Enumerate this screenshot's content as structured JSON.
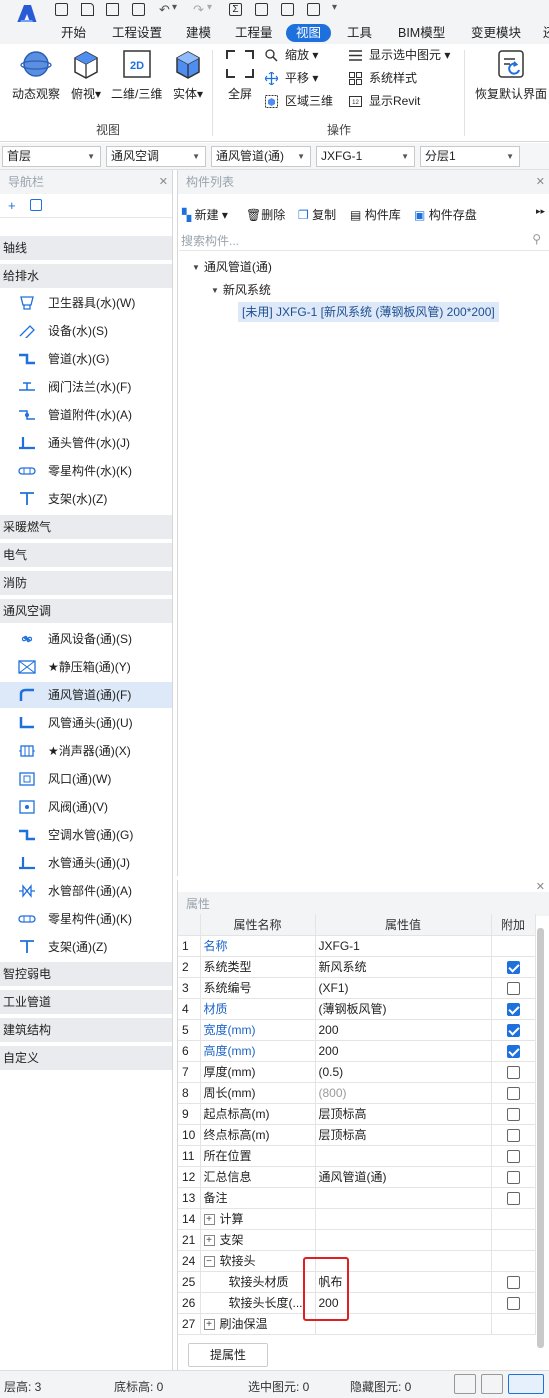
{
  "menu_tabs": [
    "开始",
    "工程设置",
    "建模",
    "工程量",
    "视图",
    "工具",
    "BIM模型",
    "变更模块",
    "还"
  ],
  "active_tab": "视图",
  "ribbon": {
    "view_group": {
      "label": "视图",
      "buttons": [
        "动态观察",
        "俯视",
        "二维/三维",
        "实体"
      ]
    },
    "operate_group": {
      "label": "操作",
      "fullscreen": "全屏",
      "zoom": "缩放",
      "pan": "平移",
      "region3d": "区域三维",
      "show_selected": "显示选中图元",
      "system_style": "系统样式",
      "show_revit": "显示Revit"
    },
    "restore": "恢复默认界面"
  },
  "selectors": [
    "首层",
    "通风空调",
    "通风管道(通)",
    "JXFG-1",
    "分层1"
  ],
  "nav": {
    "title": "导航栏",
    "categories": {
      "axis": "轴线",
      "water": "给排水",
      "heating": "采暖燃气",
      "electric": "电气",
      "fire": "消防",
      "hvac": "通风空调",
      "smart": "智控弱电",
      "industrial": "工业管道",
      "structure": "建筑结构",
      "custom": "自定义"
    },
    "water_items": [
      "卫生器具(水)(W)",
      "设备(水)(S)",
      "管道(水)(G)",
      "阀门法兰(水)(F)",
      "管道附件(水)(A)",
      "通头管件(水)(J)",
      "零星构件(水)(K)",
      "支架(水)(Z)"
    ],
    "hvac_items": [
      "通风设备(通)(S)",
      "★静压箱(通)(Y)",
      "通风管道(通)(F)",
      "风管通头(通)(U)",
      "★消声器(通)(X)",
      "风口(通)(W)",
      "风阀(通)(V)",
      "空调水管(通)(G)",
      "水管通头(通)(J)",
      "水管部件(通)(A)",
      "零星构件(通)(K)",
      "支架(通)(Z)"
    ],
    "selected_item": "通风管道(通)(F)"
  },
  "component_list": {
    "title": "构件列表",
    "new": "新建",
    "delete": "删除",
    "copy": "复制",
    "library": "构件库",
    "save": "构件存盘",
    "search_placeholder": "搜索构件...",
    "tree_root": "通风管道(通)",
    "tree_child": "新风系统",
    "tree_leaf": "[未用] JXFG-1 [新风系统 (薄钢板风管) 200*200]"
  },
  "properties": {
    "title": "属性",
    "headers": [
      "属性名称",
      "属性值",
      "附加"
    ],
    "rows": [
      {
        "n": "1",
        "k": "名称",
        "v": "JXFG-1",
        "blue": true,
        "cb": "none"
      },
      {
        "n": "2",
        "k": "系统类型",
        "v": "新风系统",
        "blue": false,
        "cb": "on"
      },
      {
        "n": "3",
        "k": "系统编号",
        "v": "(XF1)",
        "blue": false,
        "cb": "off"
      },
      {
        "n": "4",
        "k": "材质",
        "v": "(薄钢板风管)",
        "blue": true,
        "cb": "on"
      },
      {
        "n": "5",
        "k": "宽度(mm)",
        "v": "200",
        "blue": true,
        "cb": "on"
      },
      {
        "n": "6",
        "k": "高度(mm)",
        "v": "200",
        "blue": true,
        "cb": "on"
      },
      {
        "n": "7",
        "k": "厚度(mm)",
        "v": "(0.5)",
        "blue": false,
        "cb": "off"
      },
      {
        "n": "8",
        "k": "周长(mm)",
        "v": "(800)",
        "blue": false,
        "cb": "off",
        "grey": true
      },
      {
        "n": "9",
        "k": "起点标高(m)",
        "v": "层顶标高",
        "blue": false,
        "cb": "off"
      },
      {
        "n": "10",
        "k": "终点标高(m)",
        "v": "层顶标高",
        "blue": false,
        "cb": "off"
      },
      {
        "n": "11",
        "k": "所在位置",
        "v": "",
        "blue": false,
        "cb": "off"
      },
      {
        "n": "12",
        "k": "汇总信息",
        "v": "通风管道(通)",
        "blue": false,
        "cb": "off"
      },
      {
        "n": "13",
        "k": "备注",
        "v": "",
        "blue": false,
        "cb": "off"
      },
      {
        "n": "14",
        "k": "计算",
        "v": "",
        "blue": false,
        "cb": "none",
        "group": "+"
      },
      {
        "n": "21",
        "k": "支架",
        "v": "",
        "blue": false,
        "cb": "none",
        "group": "+"
      },
      {
        "n": "24",
        "k": "软接头",
        "v": "",
        "blue": false,
        "cb": "none",
        "group": "-"
      },
      {
        "n": "25",
        "k": "软接头材质",
        "v": "帆布",
        "blue": false,
        "cb": "off",
        "sub": true
      },
      {
        "n": "26",
        "k": "软接头长度(...",
        "v": "200",
        "blue": false,
        "cb": "off",
        "sub": true
      },
      {
        "n": "27",
        "k": "刷油保温",
        "v": "",
        "blue": false,
        "cb": "none",
        "group": "+"
      }
    ],
    "extract_button": "提属性"
  },
  "status": {
    "floor_height": "层高: 3",
    "bottom_height": "底标高: 0",
    "selected": "选中图元: 0",
    "hidden": "隐藏图元: 0"
  }
}
